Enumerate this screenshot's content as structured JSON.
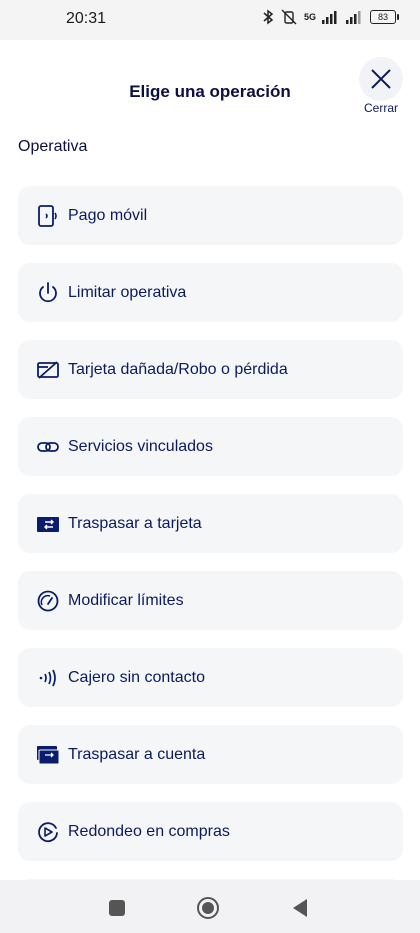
{
  "status_bar": {
    "time": "20:31",
    "network": "5G",
    "battery": "83"
  },
  "header": {
    "title": "Elige una operación",
    "close_label": "Cerrar"
  },
  "section": {
    "title": "Operativa"
  },
  "items": [
    {
      "label": "Pago móvil",
      "icon": "phone-contactless-icon"
    },
    {
      "label": "Limitar operativa",
      "icon": "power-icon"
    },
    {
      "label": "Tarjeta dañada/Robo o pérdida",
      "icon": "card-crossed-icon"
    },
    {
      "label": "Servicios vinculados",
      "icon": "link-icon"
    },
    {
      "label": "Traspasar a tarjeta",
      "icon": "transfer-to-card-icon"
    },
    {
      "label": "Modificar límites",
      "icon": "gauge-icon"
    },
    {
      "label": "Cajero sin contacto",
      "icon": "contactless-icon"
    },
    {
      "label": "Traspasar a cuenta",
      "icon": "transfer-to-account-icon"
    },
    {
      "label": "Redondeo en compras",
      "icon": "roundup-icon"
    }
  ],
  "colors": {
    "primary": "#0b1b5c",
    "card_bg": "#f5f6f7",
    "icon_fill": "#0a1c6b"
  }
}
